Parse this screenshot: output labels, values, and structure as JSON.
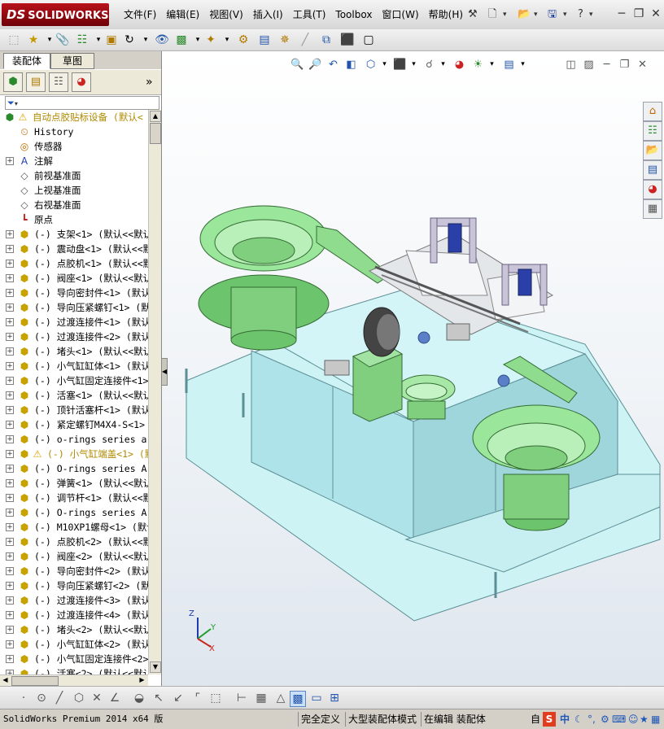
{
  "app": {
    "logo_prefix": "DS",
    "logo_text": "SOLIDWORKS"
  },
  "menu": [
    {
      "id": "file",
      "label": "文件(F)"
    },
    {
      "id": "edit",
      "label": "编辑(E)"
    },
    {
      "id": "view",
      "label": "视图(V)"
    },
    {
      "id": "insert",
      "label": "插入(I)"
    },
    {
      "id": "tools",
      "label": "工具(T)"
    },
    {
      "id": "toolbox",
      "label": "Toolbox"
    },
    {
      "id": "window",
      "label": "窗口(W)"
    },
    {
      "id": "help",
      "label": "帮助(H)"
    }
  ],
  "panel_tabs": {
    "assembly": "装配体",
    "drawing": "草图"
  },
  "feature_tree": [
    {
      "label": "自动点胶贴标设备  (默认<",
      "type": "root",
      "expand": "",
      "warn": true
    },
    {
      "label": "History",
      "type": "history",
      "expand": ""
    },
    {
      "label": "传感器",
      "type": "sensor",
      "expand": ""
    },
    {
      "label": "注解",
      "type": "annotation",
      "expand": "+"
    },
    {
      "label": "前视基准面",
      "type": "plane",
      "expand": ""
    },
    {
      "label": "上视基准面",
      "type": "plane",
      "expand": ""
    },
    {
      "label": "右视基准面",
      "type": "plane",
      "expand": ""
    },
    {
      "label": "原点",
      "type": "origin",
      "expand": ""
    },
    {
      "label": "(-) 支架<1> (默认<<默认",
      "type": "part",
      "expand": "+"
    },
    {
      "label": "(-) 震动盘<1> (默认<<默",
      "type": "part",
      "expand": "+"
    },
    {
      "label": "(-) 点胶机<1> (默认<<默",
      "type": "part",
      "expand": "+"
    },
    {
      "label": "(-) 阀座<1> (默认<<默认",
      "type": "part",
      "expand": "+"
    },
    {
      "label": "(-) 导向密封件<1> (默认",
      "type": "part",
      "expand": "+"
    },
    {
      "label": "(-) 导向压紧螺钉<1> (默",
      "type": "part",
      "expand": "+"
    },
    {
      "label": "(-) 过渡连接件<1> (默认",
      "type": "part",
      "expand": "+"
    },
    {
      "label": "(-) 过渡连接件<2> (默认",
      "type": "part",
      "expand": "+"
    },
    {
      "label": "(-) 堵头<1> (默认<<默认",
      "type": "part",
      "expand": "+"
    },
    {
      "label": "(-) 小气缸缸体<1> (默认",
      "type": "part",
      "expand": "+"
    },
    {
      "label": "(-) 小气缸固定连接件<1>",
      "type": "part",
      "expand": "+"
    },
    {
      "label": "(-) 活塞<1> (默认<<默认",
      "type": "part",
      "expand": "+"
    },
    {
      "label": "(-) 顶针活塞杆<1> (默认",
      "type": "part",
      "expand": "+"
    },
    {
      "label": "(-) 紧定螺钉M4X4-S<1> (",
      "type": "part",
      "expand": "+"
    },
    {
      "label": "(-) o-rings series a gb",
      "type": "part",
      "expand": "+"
    },
    {
      "label": "(-) 小气缸端盖<1> (默",
      "type": "part",
      "expand": "+",
      "warn": true
    },
    {
      "label": "(-) O-rings series A GB",
      "type": "part",
      "expand": "+"
    },
    {
      "label": "(-) 弹簧<1> (默认<<默认",
      "type": "part",
      "expand": "+"
    },
    {
      "label": "(-) 调节杆<1> (默认<<默",
      "type": "part",
      "expand": "+"
    },
    {
      "label": "(-) O-rings series A GB",
      "type": "part",
      "expand": "+"
    },
    {
      "label": "(-) M10XP1螺母<1> (默认",
      "type": "part",
      "expand": "+"
    },
    {
      "label": "(-) 点胶机<2> (默认<<默",
      "type": "part",
      "expand": "+"
    },
    {
      "label": "(-) 阀座<2> (默认<<默认",
      "type": "part",
      "expand": "+"
    },
    {
      "label": "(-) 导向密封件<2> (默认",
      "type": "part",
      "expand": "+"
    },
    {
      "label": "(-) 导向压紧螺钉<2> (默",
      "type": "part",
      "expand": "+"
    },
    {
      "label": "(-) 过渡连接件<3> (默认",
      "type": "part",
      "expand": "+"
    },
    {
      "label": "(-) 过渡连接件<4> (默认",
      "type": "part",
      "expand": "+"
    },
    {
      "label": "(-) 堵头<2> (默认<<默认",
      "type": "part",
      "expand": "+"
    },
    {
      "label": "(-) 小气缸缸体<2> (默认",
      "type": "part",
      "expand": "+"
    },
    {
      "label": "(-) 小气缸固定连接件<2>",
      "type": "part",
      "expand": "+"
    },
    {
      "label": "(-) 活塞<2> (默认<<默认",
      "type": "part",
      "expand": "+"
    }
  ],
  "triad": {
    "x": "X",
    "y": "Y",
    "z": "Z"
  },
  "status": {
    "version": "SolidWorks Premium 2014 x64 版",
    "definition": "完全定义",
    "mode": "大型装配体模式",
    "editing": "在编辑 装配体",
    "ime_prefix": "自",
    "ime_mode": "中"
  },
  "colors": {
    "logo_red": "#b9121b",
    "bowl_green": "#8ee28e",
    "table_cyan": "#bfeff2",
    "warning_yellow": "#ffd700"
  }
}
